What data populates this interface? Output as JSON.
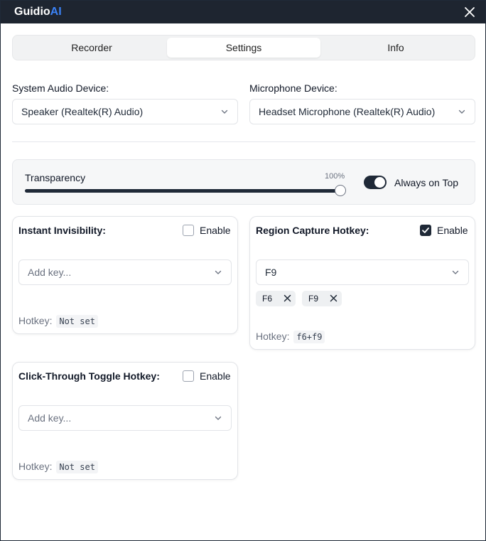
{
  "app": {
    "logo_main": "Guidio",
    "logo_accent": "AI"
  },
  "tabs": [
    {
      "label": "Recorder",
      "active": false
    },
    {
      "label": "Settings",
      "active": true
    },
    {
      "label": "Info",
      "active": false
    }
  ],
  "devices": {
    "system_audio_label": "System Audio Device:",
    "system_audio_value": "Speaker (Realtek(R) Audio)",
    "microphone_label": "Microphone Device:",
    "microphone_value": "Headset Microphone (Realtek(R) Audio)"
  },
  "transparency": {
    "label": "Transparency",
    "value_text": "100%",
    "value": 100,
    "always_on_top_label": "Always on Top",
    "always_on_top": true
  },
  "instant_invisibility": {
    "title": "Instant Invisibility:",
    "enable_label": "Enable",
    "enabled": false,
    "placeholder": "Add key...",
    "hotkey_label": "Hotkey:",
    "hotkey_value": "Not set"
  },
  "region_capture": {
    "title": "Region Capture Hotkey:",
    "enable_label": "Enable",
    "enabled": true,
    "selected_key": "F9",
    "chips": [
      "F6",
      "F9"
    ],
    "hotkey_label": "Hotkey:",
    "hotkey_value": "f6+f9"
  },
  "click_through": {
    "title": "Click-Through Toggle Hotkey:",
    "enable_label": "Enable",
    "enabled": false,
    "placeholder": "Add key...",
    "hotkey_label": "Hotkey:",
    "hotkey_value": "Not set"
  },
  "icons": {
    "close": "close-icon",
    "chevron": "chevron-down-icon",
    "check": "check-icon",
    "remove": "x-icon"
  },
  "colors": {
    "titlebar": "#1e2530",
    "accent": "#3b82f6",
    "dark": "#1f2937"
  }
}
